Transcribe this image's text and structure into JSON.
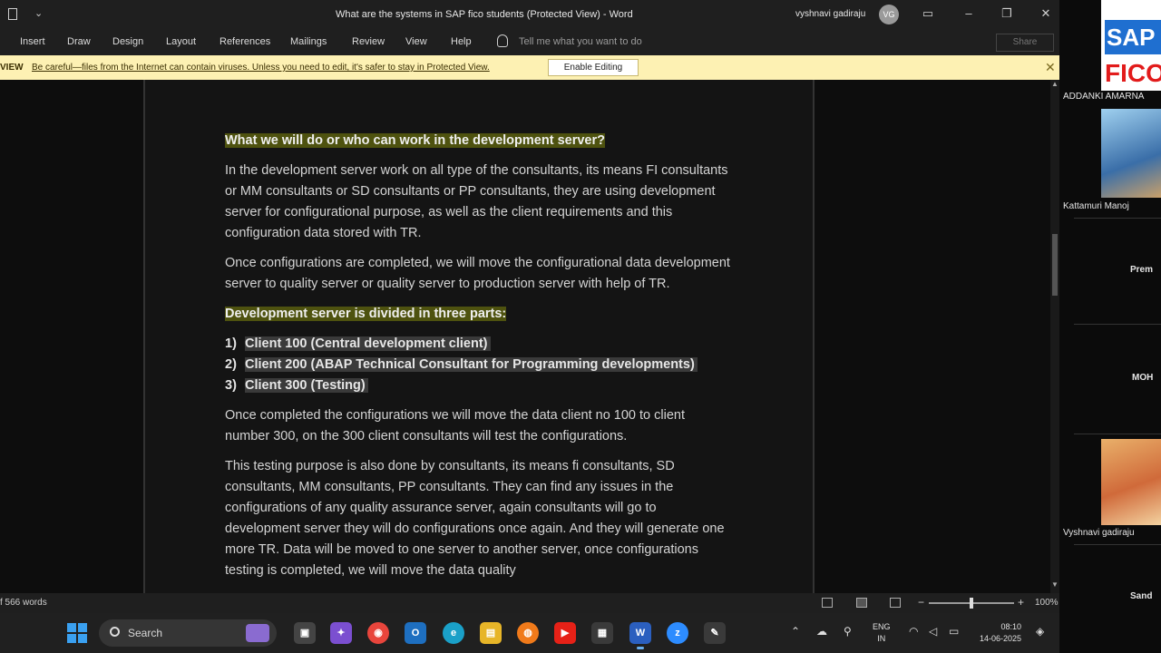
{
  "window": {
    "title": "What are the systems in SAP fico students (Protected View) - Word",
    "user_name": "vyshnavi gadiraju",
    "user_initials": "VG"
  },
  "ribbon": {
    "tabs": [
      "Insert",
      "Draw",
      "Design",
      "Layout",
      "References",
      "Mailings",
      "Review",
      "View",
      "Help"
    ],
    "tell_me": "Tell me what you want to do",
    "share": "Share"
  },
  "protected_view": {
    "tag": "VIEW",
    "message": "Be careful—files from the Internet can contain viruses. Unless you need to edit, it's safer to stay in Protected View.",
    "enable_button": "Enable Editing"
  },
  "document": {
    "heading1": "What we will do or who can work in the development server?",
    "para1": "In the development server work on all type of the consultants, its means FI consultants or MM consultants or SD consultants or PP consultants, they are using development server for configurational purpose, as well as the client requirements and this configuration data stored with TR.",
    "para2": "Once configurations are completed, we will move the configurational data development server to quality server or quality server to production server with help of TR.",
    "heading2": "Development server is divided in three parts:",
    "list": [
      {
        "num": "1)",
        "text": "Client 100 (Central development client)"
      },
      {
        "num": "2)",
        "text": "Client 200 (ABAP Technical Consultant for Programming developments)"
      },
      {
        "num": "3)",
        "text": "Client 300 (Testing)"
      }
    ],
    "para3": "Once completed the configurations we will move the data client no 100 to client number 300, on the 300 client consultants will test the configurations.",
    "para4": "This testing purpose is also done by consultants, its means fi consultants, SD consultants, MM consultants, PP consultants. They can find any issues in the configurations of any quality assurance server, again consultants will go to development server they will do configurations once again. And they will generate one more TR. Data will be moved to one server to another server, once configurations testing is completed, we will move the data quality"
  },
  "status": {
    "words": "f 566 words",
    "zoom": "100%",
    "zoom_level": 1.0
  },
  "taskbar": {
    "search_placeholder": "Search",
    "language": "ENG",
    "region": "IN",
    "time": "08:10",
    "date": "14-06-2025"
  },
  "participants": {
    "top_name": "ADDANKI AMARNA",
    "names": [
      "Kattamuri Manoj",
      "Prem",
      "MOH",
      "Vyshnavi gadiraju",
      "Sand"
    ]
  },
  "colors": {
    "protected_bar": "#fdf1b3",
    "heading_highlight": "#4e520f",
    "accent": "#3aa0f0"
  }
}
